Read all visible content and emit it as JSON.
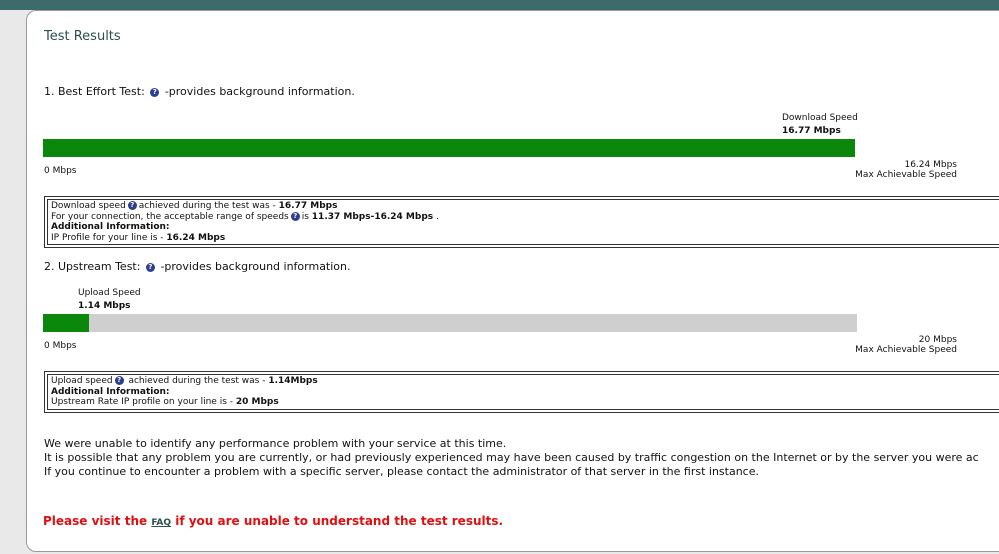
{
  "page": {
    "title": "Test Results"
  },
  "best_effort": {
    "heading_prefix": "1. Best Effort Test:",
    "heading_suffix": "-provides background information.",
    "speed_label": "Download Speed",
    "speed_value": "16.77 Mbps",
    "min_label": "0 Mbps",
    "max_value": "16.24 Mbps",
    "max_label": "Max Achievable Speed",
    "fill_fraction": 1.0,
    "info": {
      "line1_a": "Download speed",
      "line1_b": "achieved during the test was - ",
      "line1_val": "16.77 Mbps",
      "line2_a": "For your connection, the acceptable range of speeds",
      "line2_b": "is ",
      "line2_val": "11.37 Mbps-16.24 Mbps",
      "line2_end": " .",
      "line3": "Additional Information:",
      "line4_a": "IP Profile for your line is - ",
      "line4_val": "16.24 Mbps"
    }
  },
  "upstream": {
    "heading_prefix": "2. Upstream Test:",
    "heading_suffix": "-provides background information.",
    "speed_label": "Upload Speed",
    "speed_value": "1.14 Mbps",
    "min_label": "0 Mbps",
    "max_value": "20 Mbps",
    "max_label": "Max Achievable Speed",
    "fill_fraction": 0.057,
    "info": {
      "line1_a": "Upload speed",
      "line1_b": " achieved during the test was - ",
      "line1_val": "1.14Mbps",
      "line2": "Additional Information:",
      "line3_a": "Upstream Rate IP profile on your line is - ",
      "line3_val": "20 Mbps"
    }
  },
  "messages": {
    "line1": "We were unable to identify any performance problem with your service at this time.",
    "line2": "It is possible that any problem you are currently, or had previously experienced may have been caused by traffic congestion on the Internet or by the server you were ac",
    "line3": "If you continue to encounter a problem with a specific server, please contact the administrator of that server in the first instance."
  },
  "visit": {
    "prefix": "Please visit the ",
    "link": "FAQ",
    "suffix": " if you are unable to understand the test results."
  },
  "colors": {
    "bar_fill": "#0b870b",
    "bar_track": "#cfcfcf",
    "title": "#2b4e50",
    "alert": "#e01010"
  },
  "icons": {
    "help": "question-circle-icon"
  }
}
